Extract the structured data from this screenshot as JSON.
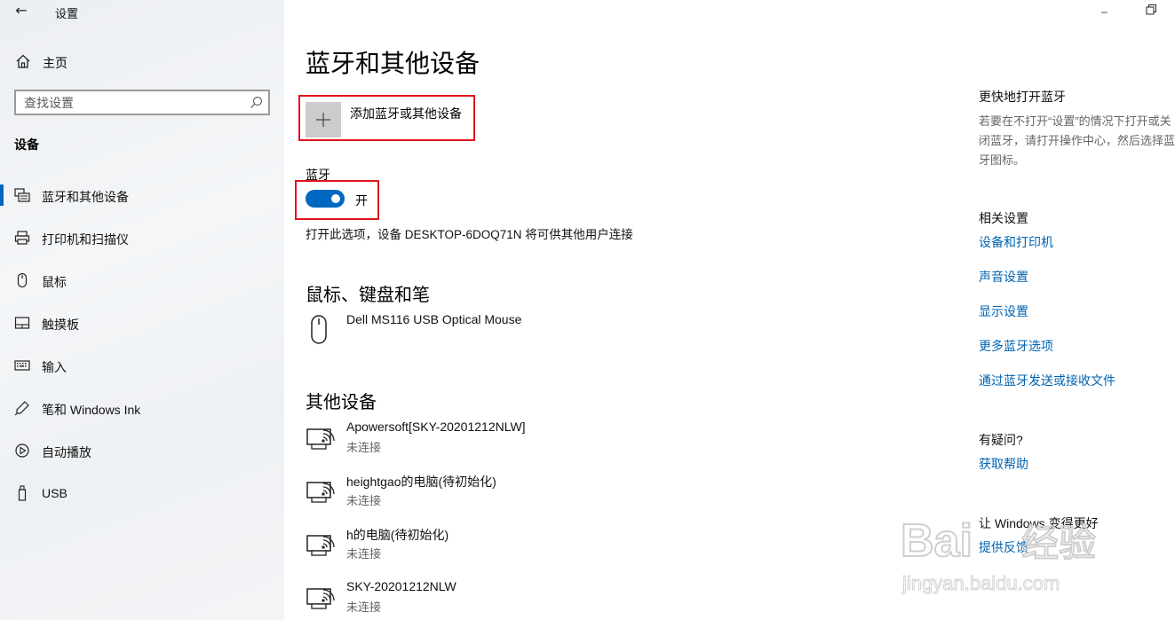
{
  "window": {
    "title": "设置",
    "minimize_glyph": "–",
    "restore_glyph": "❐"
  },
  "sidebar": {
    "home_label": "主页",
    "search_placeholder": "查找设置",
    "section_label": "设备",
    "items": [
      {
        "label": "蓝牙和其他设备",
        "icon": "bluetooth-devices-icon",
        "active": true
      },
      {
        "label": "打印机和扫描仪",
        "icon": "printer-icon"
      },
      {
        "label": "鼠标",
        "icon": "mouse-icon"
      },
      {
        "label": "触摸板",
        "icon": "touchpad-icon"
      },
      {
        "label": "输入",
        "icon": "keyboard-icon"
      },
      {
        "label": "笔和 Windows Ink",
        "icon": "pen-icon"
      },
      {
        "label": "自动播放",
        "icon": "autoplay-icon"
      },
      {
        "label": "USB",
        "icon": "usb-icon"
      }
    ]
  },
  "main": {
    "title": "蓝牙和其他设备",
    "add_device_label": "添加蓝牙或其他设备",
    "bluetooth": {
      "label": "蓝牙",
      "state": "开",
      "on": true,
      "description": "打开此选项，设备 DESKTOP-6DOQ71N 将可供其他用户连接"
    },
    "mouse_section": {
      "title": "鼠标、键盘和笔",
      "devices": [
        {
          "name": "Dell MS116 USB Optical Mouse",
          "icon": "mouse-icon"
        }
      ]
    },
    "other_section": {
      "title": "其他设备",
      "devices": [
        {
          "name": "Apowersoft[SKY-20201212NLW]",
          "status": "未连接",
          "icon": "wireless-display-icon"
        },
        {
          "name": "heightgao的电脑(待初始化)",
          "status": "未连接",
          "icon": "wireless-display-icon"
        },
        {
          "name": "h的电脑(待初始化)",
          "status": "未连接",
          "icon": "wireless-display-icon"
        },
        {
          "name": "SKY-20201212NLW",
          "status": "未连接",
          "icon": "wireless-display-icon"
        }
      ]
    }
  },
  "right": {
    "quick_title": "更快地打开蓝牙",
    "quick_text": "若要在不打开“设置”的情况下打开或关闭蓝牙，请打开操作中心，然后选择蓝牙图标。",
    "related_title": "相关设置",
    "related_links": [
      "设备和打印机",
      "声音设置",
      "显示设置",
      "更多蓝牙选项",
      "通过蓝牙发送或接收文件"
    ],
    "help_title": "有疑问?",
    "help_link": "获取帮助",
    "feedback_title": "让 Windows 变得更好",
    "feedback_link": "提供反馈"
  },
  "watermark": {
    "brand": "Bai",
    "brand_cn": "经验",
    "url": "jingyan.baidu.com"
  },
  "colors": {
    "accent": "#0067c0",
    "link": "#0063b1",
    "highlight": "#e0141e"
  }
}
